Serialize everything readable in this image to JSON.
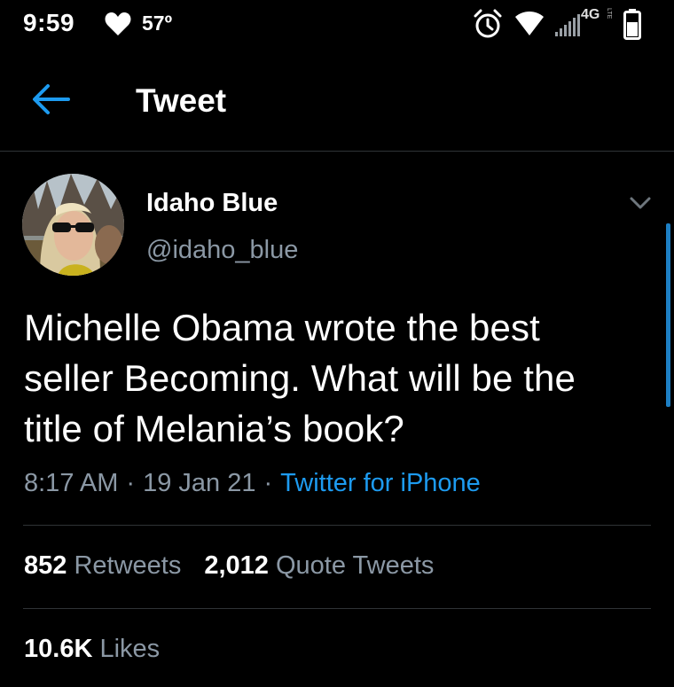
{
  "status_bar": {
    "time": "9:59",
    "temperature": "57º",
    "network": "4G",
    "network_sub": "LTE",
    "icons": [
      "heart-icon",
      "alarm-icon",
      "wifi-icon",
      "signal-icon",
      "battery-icon"
    ]
  },
  "header": {
    "title": "Tweet",
    "back_icon": "arrow-left-icon"
  },
  "tweet": {
    "display_name": "Idaho Blue",
    "handle": "@idaho_blue",
    "text_lines": [
      "Michelle Obama wrote the best",
      "seller Becoming. What will be the",
      "title of Melania’s book?"
    ],
    "time": "8:17 AM",
    "separator": "·",
    "date": "19 Jan 21",
    "source": "Twitter for iPhone"
  },
  "stats": {
    "retweets_count": "852",
    "retweets_label": "Retweets",
    "quotes_count": "2,012",
    "quotes_label": "Quote Tweets",
    "likes_count": "10.6K",
    "likes_label": "Likes"
  },
  "colors": {
    "background": "#000000",
    "text": "#ffffff",
    "secondary_text": "#8b98a5",
    "accent": "#1d9bf0",
    "divider": "#2f3336"
  }
}
